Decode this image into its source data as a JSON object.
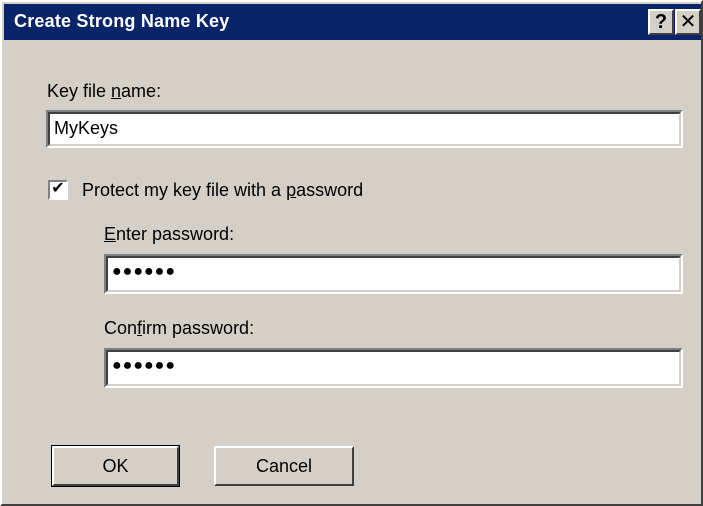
{
  "window": {
    "title": "Create Strong Name Key",
    "help_label": "?",
    "close_label": "✕"
  },
  "form": {
    "key_file_label_pre": "Key file ",
    "key_file_label_accel": "n",
    "key_file_label_post": "ame:",
    "key_file_value": "MyKeys",
    "protect_checked": true,
    "protect_mark": "✔",
    "protect_label_pre": "Protect my key file with a ",
    "protect_label_accel": "p",
    "protect_label_post": "assword",
    "enter_pw_label_accel": "E",
    "enter_pw_label_post": "nter password:",
    "enter_pw_value": "●●●●●●",
    "confirm_pw_label_pre": "Con",
    "confirm_pw_label_accel": "f",
    "confirm_pw_label_post": "irm password:",
    "confirm_pw_value": "●●●●●●"
  },
  "buttons": {
    "ok_label": "OK",
    "cancel_label": "Cancel"
  }
}
